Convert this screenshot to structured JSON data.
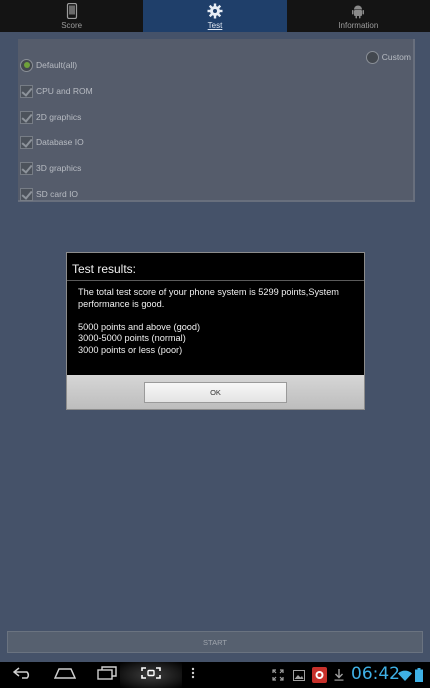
{
  "tabs": [
    {
      "label": "Score",
      "icon": "phone-icon",
      "active": false
    },
    {
      "label": "Test",
      "icon": "gear-icon",
      "active": true
    },
    {
      "label": "Information",
      "icon": "android-icon",
      "active": false
    }
  ],
  "options": {
    "default_label": "Default(all)",
    "custom_label": "Custom",
    "items": [
      "CPU and ROM",
      "2D graphics",
      "Database IO",
      "3D graphics",
      "SD card IO"
    ]
  },
  "start_label": "START",
  "dialog": {
    "title": "Test results:",
    "message_1": "The total test score of your phone system is 5299 points,System performance is good.",
    "line_good": "5000 points and above (good)",
    "line_normal": "3000-5000 points (normal)",
    "line_poor": "3000 points or less (poor)",
    "ok_label": "OK"
  },
  "status": {
    "time": "06:42"
  },
  "colors": {
    "active_tab": "#1f3f6a",
    "clock": "#3fb1e6",
    "radio_selected": "#6fa13a"
  }
}
